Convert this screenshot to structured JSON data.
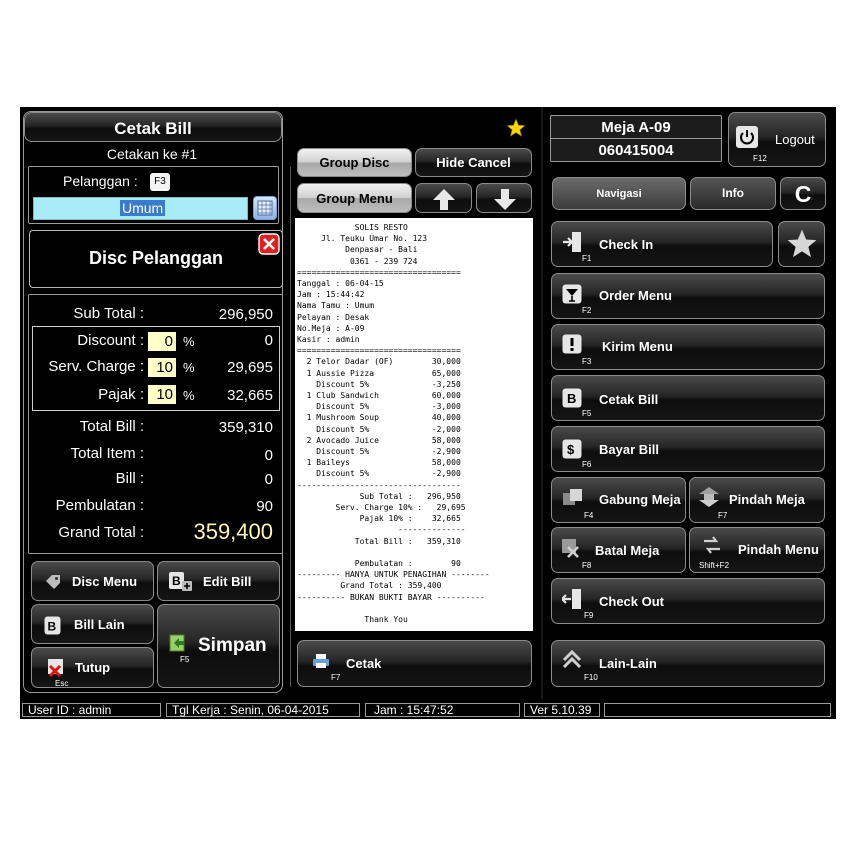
{
  "left": {
    "title": "Cetak Bill",
    "cetakan": "Cetakan ke #1",
    "pelanggan_label": "Pelanggan :",
    "pelanggan_key": "F3",
    "pelanggan_value": "Umum",
    "disc_pelanggan": "Disc Pelanggan",
    "subtotal_label": "Sub Total :",
    "subtotal_value": "296,950",
    "discount_label": "Discount :",
    "discount_pct": "0",
    "discount_value": "0",
    "service_label": "Serv. Charge :",
    "service_pct": "10",
    "service_value": "29,695",
    "pajak_label": "Pajak :",
    "pajak_pct": "10",
    "pajak_value": "32,665",
    "pct_sign": "%",
    "totalbill_label": "Total Bill :",
    "totalbill_value": "359,310",
    "totalitem_label": "Total Item :",
    "totalitem_value": "0",
    "bill_label": "Bill :",
    "bill_value": "0",
    "pembulatan_label": "Pembulatan :",
    "pembulatan_value": "90",
    "grandtotal_label": "Grand Total :",
    "grandtotal_value": "359,400",
    "disc_menu": "Disc Menu",
    "edit_bill": "Edit Bill",
    "bill_lain": "Bill Lain",
    "simpan": "Simpan",
    "simpan_key": "F5",
    "tutup": "Tutup",
    "tutup_key": "Esc"
  },
  "middle": {
    "group_disc": "Group Disc",
    "hide_cancel": "Hide Cancel",
    "group_menu": "Group Menu",
    "cetak": "Cetak",
    "cetak_key": "F7"
  },
  "receipt": {
    "lines": [
      "            SOLIS RESTO",
      "     Jl. Teuku Umar No. 123",
      "          Denpasar - Bali",
      "           0361 - 239 724",
      "==================================",
      "Tanggal : 06-04-15",
      "Jam : 15:44:42",
      "Nama Tamu : Umum",
      "Pelayan : Desak",
      "No.Meja : A-09",
      "Kasir : admin",
      "==================================",
      "  2 Telor Dadar (OF)        30,000",
      "  1 Aussie Pizza            65,000",
      "    Discount 5%             -3,250",
      "  1 Club Sandwich           60,000",
      "    Discount 5%             -3,000",
      "  1 Mushroom Soup           40,000",
      "    Discount 5%             -2,000",
      "  2 Avocado Juice           58,000",
      "    Discount 5%             -2,900",
      "  1 Baileys                 58,000",
      "    Discount 5%             -2,900",
      "----------------------------------",
      "             Sub Total :   296,950",
      "        Serv. Charge 10% :   29,695",
      "             Pajak 10% :    32,665",
      "                     --------------",
      "            Total Bill :   359,310",
      "",
      "            Pembulatan :        90",
      "--------- HANYA UNTUK PENAGIHAN --------",
      "         Grand Total : 359,400",
      "---------- BUKAN BUKTI BAYAR ----------",
      "",
      "              Thank You"
    ]
  },
  "right": {
    "meja": "Meja A-09",
    "meja_code": "060415004",
    "logout": "Logout",
    "logout_key": "F12",
    "tab_navigasi": "Navigasi",
    "tab_info": "Info",
    "tab_c": "C",
    "checkin": "Check In",
    "checkin_key": "F1",
    "order_menu": "Order Menu",
    "order_key": "F2",
    "kirim_menu": "Kirim Menu",
    "kirim_key": "F3",
    "cetak_bill": "Cetak Bill",
    "cetak_bill_key": "F5",
    "bayar_bill": "Bayar Bill",
    "bayar_key": "F6",
    "gabung_meja": "Gabung Meja",
    "gabung_key": "F4",
    "pindah_meja": "Pindah Meja",
    "pindah_key": "F7",
    "batal_meja": "Batal Meja",
    "batal_key": "F8",
    "pindah_menu": "Pindah Menu",
    "pindah_menu_key": "Shift+F2",
    "checkout": "Check Out",
    "checkout_key": "F9",
    "lain": "Lain-Lain",
    "lain_key": "F10"
  },
  "status": {
    "user": "User ID : admin",
    "tgl": "Tgl Kerja : Senin, 06-04-2015",
    "jam": "Jam : 15:47:52",
    "ver": "Ver 5.10.39"
  }
}
